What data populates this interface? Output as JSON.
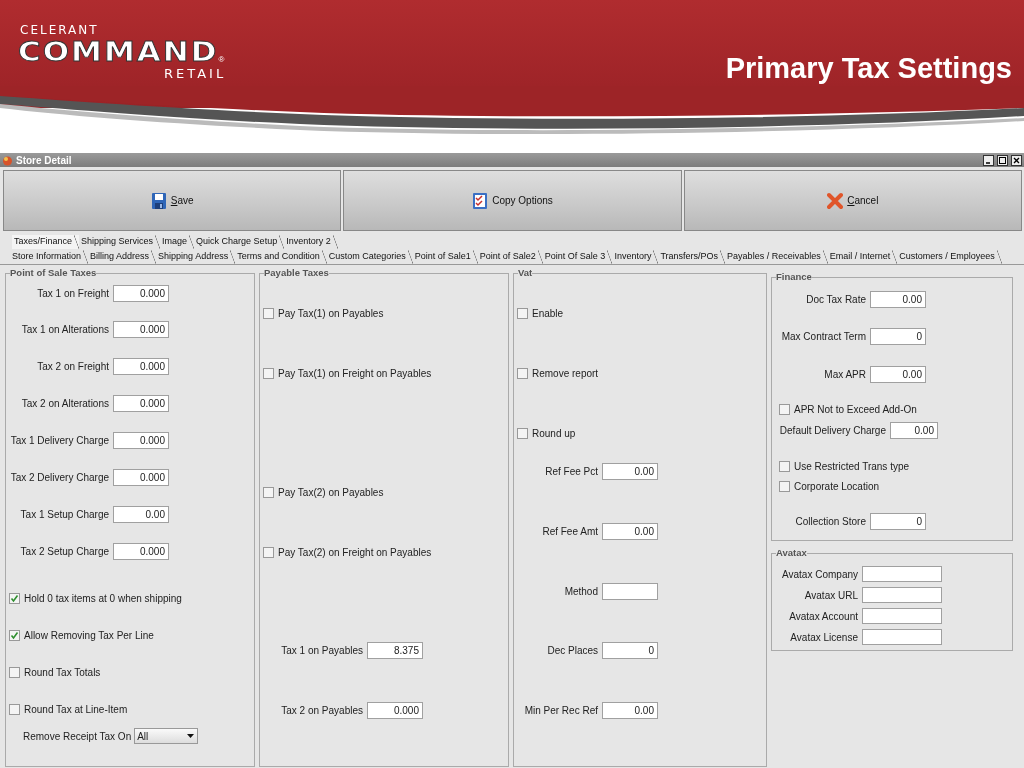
{
  "slide": {
    "logo": {
      "line_1": "CELERANT",
      "line_2": "COMMAND",
      "mark": "®",
      "line_3": "RETAIL"
    },
    "title": "Primary Tax Settings"
  },
  "window": {
    "title": "Store Detail"
  },
  "toolbar": [
    {
      "label": "Save",
      "kind": "save",
      "mnemonic": true
    },
    {
      "label": "Copy Options",
      "kind": "copy",
      "mnemonic": false
    },
    {
      "label": "Cancel",
      "kind": "cancel",
      "mnemonic": true
    }
  ],
  "tab_rows": [
    {
      "tabs": [
        {
          "label": "Taxes/Finance",
          "selected": true
        },
        {
          "label": "Shipping Services",
          "selected": false
        },
        {
          "label": "Image",
          "selected": false
        },
        {
          "label": "Quick Charge Setup",
          "selected": false
        },
        {
          "label": "Inventory 2",
          "selected": false
        }
      ]
    },
    {
      "tabs": [
        {
          "label": "Store Information",
          "selected": false
        },
        {
          "label": "Billing Address",
          "selected": false
        },
        {
          "label": "Shipping Address",
          "selected": false
        },
        {
          "label": "Terms and Condition",
          "selected": false
        },
        {
          "label": "Custom Categories",
          "selected": false
        },
        {
          "label": "Point of Sale1",
          "selected": false
        },
        {
          "label": "Point of Sale2",
          "selected": false
        },
        {
          "label": "Point Of Sale 3",
          "selected": false
        },
        {
          "label": "Inventory",
          "selected": false
        },
        {
          "label": "Transfers/POs",
          "selected": false
        },
        {
          "label": "Payables / Receivables",
          "selected": false
        },
        {
          "label": "Email / Internet",
          "selected": false
        },
        {
          "label": "Customers / Employees",
          "selected": false
        }
      ]
    }
  ],
  "panels": [
    {
      "title": "Point of Sale Taxes",
      "items": [
        {
          "kind": "field",
          "label": "Tax 1 on Freight",
          "value": "0.000"
        },
        {
          "kind": "field",
          "label": "Tax 1 on Alterations",
          "value": "0.000"
        },
        {
          "kind": "field",
          "label": "Tax 2 on Freight",
          "value": "0.000"
        },
        {
          "kind": "field",
          "label": "Tax 2 on Alterations",
          "value": "0.000"
        },
        {
          "kind": "field",
          "label": "Tax 1 Delivery Charge",
          "value": "0.000"
        },
        {
          "kind": "field",
          "label": "Tax 2 Delivery Charge",
          "value": "0.000"
        },
        {
          "kind": "field",
          "label": "Tax 1 Setup Charge",
          "value": "0.00"
        },
        {
          "kind": "field",
          "label": "Tax 2 Setup Charge",
          "value": "0.000"
        },
        {
          "kind": "checkbox",
          "label": "Hold 0 tax items at 0 when shipping",
          "checked": true
        },
        {
          "kind": "checkbox",
          "label": "Allow Removing Tax Per Line",
          "checked": true
        },
        {
          "kind": "checkbox",
          "label": "Round Tax Totals",
          "checked": false
        },
        {
          "kind": "checkbox",
          "label": "Round Tax at Line-Item",
          "checked": false
        },
        {
          "kind": "select",
          "label": "Remove Receipt Tax On",
          "value": "All"
        }
      ]
    },
    {
      "title": "Payable Taxes",
      "items": [
        {
          "kind": "checkbox",
          "label": "Pay Tax(1) on Payables",
          "checked": false
        },
        {
          "kind": "checkbox",
          "label": "Pay Tax(1) on Freight on Payables",
          "checked": false
        },
        {
          "kind": "checkbox",
          "label": "Pay Tax(2) on Payables",
          "checked": false
        },
        {
          "kind": "checkbox",
          "label": "Pay Tax(2) on Freight on Payables",
          "checked": false
        },
        {
          "kind": "field",
          "label": "Tax 1 on Payables",
          "value": "8.375"
        },
        {
          "kind": "field",
          "label": "Tax 2 on Payables",
          "value": "0.000"
        }
      ]
    },
    {
      "title": "Vat",
      "items": [
        {
          "kind": "checkbox",
          "label": "Enable",
          "checked": false
        },
        {
          "kind": "checkbox",
          "label": "Remove report",
          "checked": false
        },
        {
          "kind": "checkbox",
          "label": "Round up",
          "checked": false
        },
        {
          "kind": "field",
          "label": "Ref Fee Pct",
          "value": "0.00"
        },
        {
          "kind": "field",
          "label": "Ref Fee Amt",
          "value": "0.00"
        },
        {
          "kind": "field",
          "label": "Method"
        },
        {
          "kind": "field",
          "label": "Dec Places",
          "value": "0"
        },
        {
          "kind": "field",
          "label": "Min Per Rec Ref",
          "value": "0.00"
        }
      ]
    },
    {
      "title": "Finance",
      "items": [
        {
          "kind": "field",
          "label": "Doc Tax Rate",
          "value": "0.00"
        },
        {
          "kind": "field",
          "label": "Max Contract Term",
          "value": "0"
        },
        {
          "kind": "field",
          "label": "Max APR",
          "value": "0.00"
        },
        {
          "kind": "checkbox",
          "label": "APR Not to Exceed Add-On",
          "checked": false
        },
        {
          "kind": "field",
          "label": "Default Delivery Charge",
          "value": "0.00"
        },
        {
          "kind": "checkbox",
          "label": "Use Restricted Trans type",
          "checked": false
        },
        {
          "kind": "checkbox",
          "label": "Corporate Location",
          "checked": false
        },
        {
          "kind": "field",
          "label": "Collection Store",
          "value": "0"
        }
      ]
    },
    {
      "title": "Avatax",
      "items": [
        {
          "kind": "field",
          "label": "Avatax Company"
        },
        {
          "kind": "field",
          "label": "Avatax URL"
        },
        {
          "kind": "field",
          "label": "Avatax Account"
        },
        {
          "kind": "field",
          "label": "Avatax License"
        }
      ]
    }
  ]
}
